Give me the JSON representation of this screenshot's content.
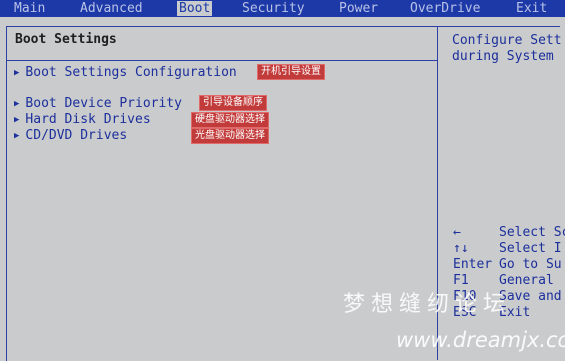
{
  "menu": {
    "tabs": [
      "Main",
      "Advanced",
      "Boot",
      "Security",
      "Power",
      "OverDrive",
      "Exit"
    ],
    "active": "Boot"
  },
  "left": {
    "title": "Boot Settings",
    "items": [
      {
        "label": "Boot Settings Configuration",
        "annotation": "开机引导设置"
      },
      {
        "label": "Boot Device Priority",
        "annotation": "引导设备顺序"
      },
      {
        "label": "Hard Disk Drives",
        "annotation": "硬盘驱动器选择"
      },
      {
        "label": "CD/DVD Drives",
        "annotation": "光盘驱动器选择"
      }
    ]
  },
  "help": {
    "line1": "Configure Sett",
    "line2": "during System"
  },
  "keys": [
    {
      "key": "←",
      "desc": "Select Sc"
    },
    {
      "key": "↑↓",
      "desc": "Select I"
    },
    {
      "key": "Enter",
      "desc": "Go to Su"
    },
    {
      "key": "F1",
      "desc": "General"
    },
    {
      "key": "F10",
      "desc": "Save and"
    },
    {
      "key": "ESC",
      "desc": "Exit"
    }
  ],
  "watermark": {
    "cn": "梦想缝纫论坛",
    "url": "www.dreamjx.com"
  }
}
